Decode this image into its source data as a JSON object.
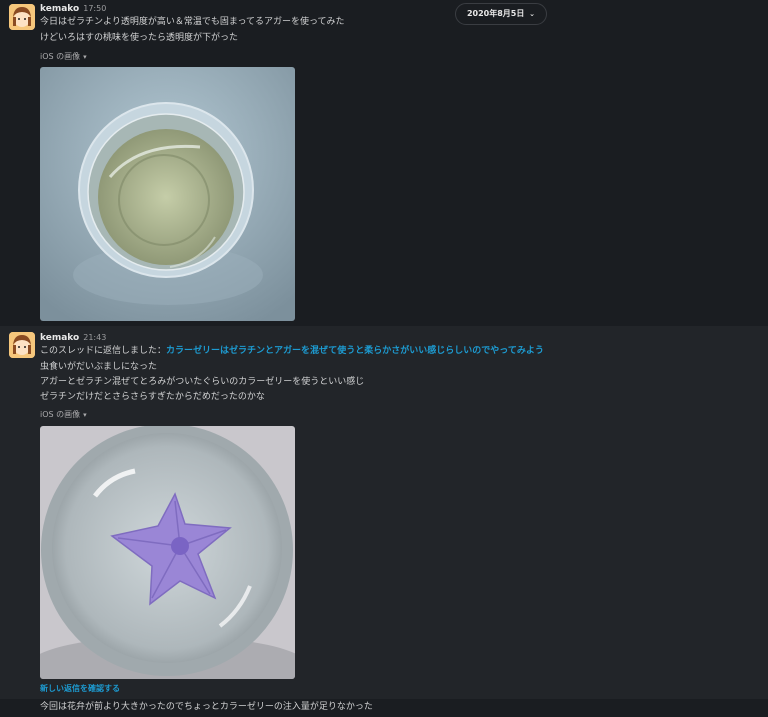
{
  "date_divider": {
    "label": "2020年8月5日",
    "icon": "chevron-down-icon"
  },
  "messages": [
    {
      "author": "kemako",
      "time": "17:50",
      "lines": [
        "今日はゼラチンより透明度が高い＆常温でも固まってるアガーを使ってみた",
        "けどいろはすの桃味を使ったら透明度が下がった"
      ],
      "attachment_label": "iOS の画像"
    },
    {
      "author": "kemako",
      "time": "21:43",
      "thread_prefix": "このスレッドに返信しました：",
      "thread_link": "カラーゼリーはゼラチンとアガーを混ぜて使うと柔らかさがいい感じらしいのでやってみよう",
      "lines": [
        "虫食いがだいぶましになった",
        "アガーとゼラチン混ぜてとろみがついたぐらいのカラーゼリーを使うといい感じ",
        "ゼラチンだけだとさらさらすぎたからだめだったのかな"
      ],
      "attachment_label": "iOS の画像",
      "new_replies_link": "新しい返信を確認する"
    },
    {
      "lines": [
        "今回は花弁が前より大きかったのでちょっとカラーゼリーの注入量が足りなかった"
      ]
    }
  ],
  "colors": {
    "background": "#1a1d21",
    "highlight_row": "#222529",
    "link": "#1d9bd1"
  }
}
